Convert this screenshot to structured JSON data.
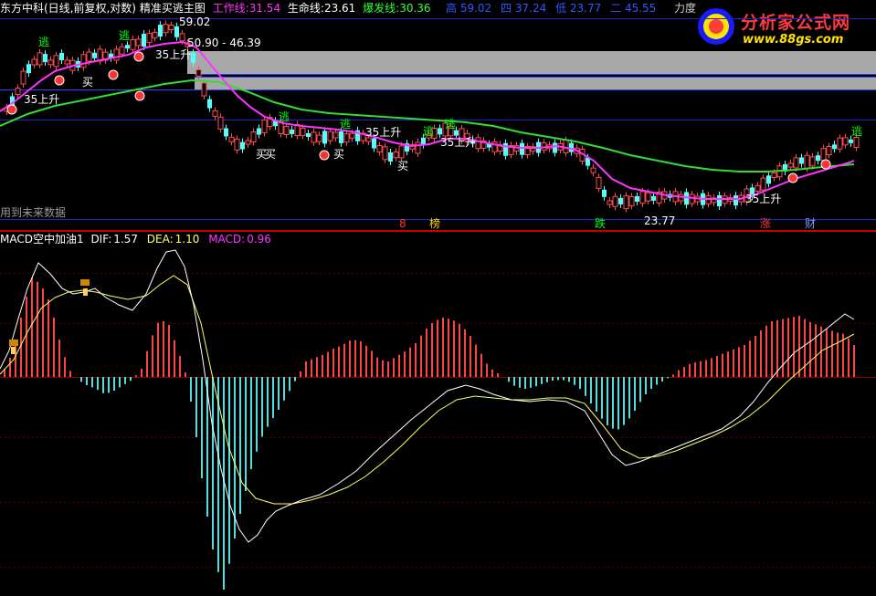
{
  "header": {
    "stock": "东方中科(日线,前复权,对数)",
    "indicator_name": "精准买逃主图",
    "work_line_label": "工作线:",
    "work_line_value": "31.54",
    "life_line_label": "生命线:",
    "life_line_value": "23.61",
    "burst_line_label": "爆发线:",
    "burst_line_value": "30.36",
    "top_key_1": "高",
    "top_value_1": "59.02",
    "top_key_2": "四",
    "top_value_2": "37.24",
    "top_key_3": "低",
    "top_value_3": "23.77",
    "top_key_4": "二",
    "top_value_4": "45.55",
    "right_label": "力度"
  },
  "watermark": {
    "title": "分析家公式网",
    "url": "www.88gs.com"
  },
  "main_panel": {
    "future_data_note": "用到未来数据",
    "high_annotation": "59.02",
    "range_annotation": "50.90 - 46.39",
    "low_annotation": "23.77",
    "signals": [
      {
        "text": "35上升",
        "color": "#ffffff"
      },
      {
        "text": "买",
        "color": "#ffffff"
      },
      {
        "text": "逃",
        "color": "#00ff00"
      },
      {
        "text": "逃",
        "color": "#00ff00"
      },
      {
        "text": "买",
        "color": "#ffffff"
      },
      {
        "text": "逃",
        "color": "#00ff00"
      },
      {
        "text": "35上升",
        "color": "#ffffff"
      },
      {
        "text": "逃",
        "color": "#00ff00"
      },
      {
        "text": "买",
        "color": "#ffffff"
      },
      {
        "text": "35上升",
        "color": "#ffffff"
      },
      {
        "text": "买",
        "color": "#ffffff"
      },
      {
        "text": "逃",
        "color": "#00ff00"
      },
      {
        "text": "逃",
        "color": "#00ff00"
      },
      {
        "text": "35上升",
        "color": "#ffffff"
      },
      {
        "text": "买",
        "color": "#ffffff"
      },
      {
        "text": "35上升",
        "color": "#ffffff"
      },
      {
        "text": "逃",
        "color": "#00ff00"
      }
    ],
    "bottom_markers": [
      {
        "text": "8",
        "color": "#ff3333"
      },
      {
        "text": "榜",
        "color": "#ffd700"
      },
      {
        "text": "跌",
        "color": "#00ff00"
      },
      {
        "text": "涨",
        "color": "#ff3333"
      },
      {
        "text": "财",
        "color": "#7b9bff"
      }
    ]
  },
  "sub_panel": {
    "name": "MACD空中加油1",
    "dif_label": "DIF:",
    "dif_value": "1.57",
    "dea_label": "DEA:",
    "dea_value": "1.10",
    "macd_label": "MACD:",
    "macd_value": "0.96"
  },
  "colors": {
    "background": "#000000",
    "up_candle": "#ff4d4d",
    "down_candle": "#54ffff",
    "work_line": "#ff33ff",
    "life_line": "#33dd33",
    "dif_line": "#ffffff",
    "dea_line": "#ffff66",
    "macd_pos": "#ff4444",
    "macd_neg": "#55dddd",
    "header_work": "#ff33ff",
    "header_life": "#ffffff",
    "header_burst": "#33ff33",
    "header_top": "#3355ff",
    "separator": "#cc0000",
    "level_line": "#2222cc"
  },
  "chart_data": [
    {
      "type": "candlestick",
      "title": "精准买逃主图",
      "series": [
        {
          "name": "工作线",
          "last_value": 31.54
        },
        {
          "name": "生命线",
          "last_value": 23.61
        },
        {
          "name": "爆发线",
          "last_value": 30.36
        }
      ],
      "annotations": {
        "high": 59.02,
        "range_low": 46.39,
        "range_high": 50.9,
        "low": 23.77
      }
    },
    {
      "type": "bar",
      "title": "MACD空中加油1",
      "series": [
        {
          "name": "DIF",
          "last_value": 1.57
        },
        {
          "name": "DEA",
          "last_value": 1.1
        },
        {
          "name": "MACD",
          "last_value": 0.96
        }
      ]
    }
  ]
}
